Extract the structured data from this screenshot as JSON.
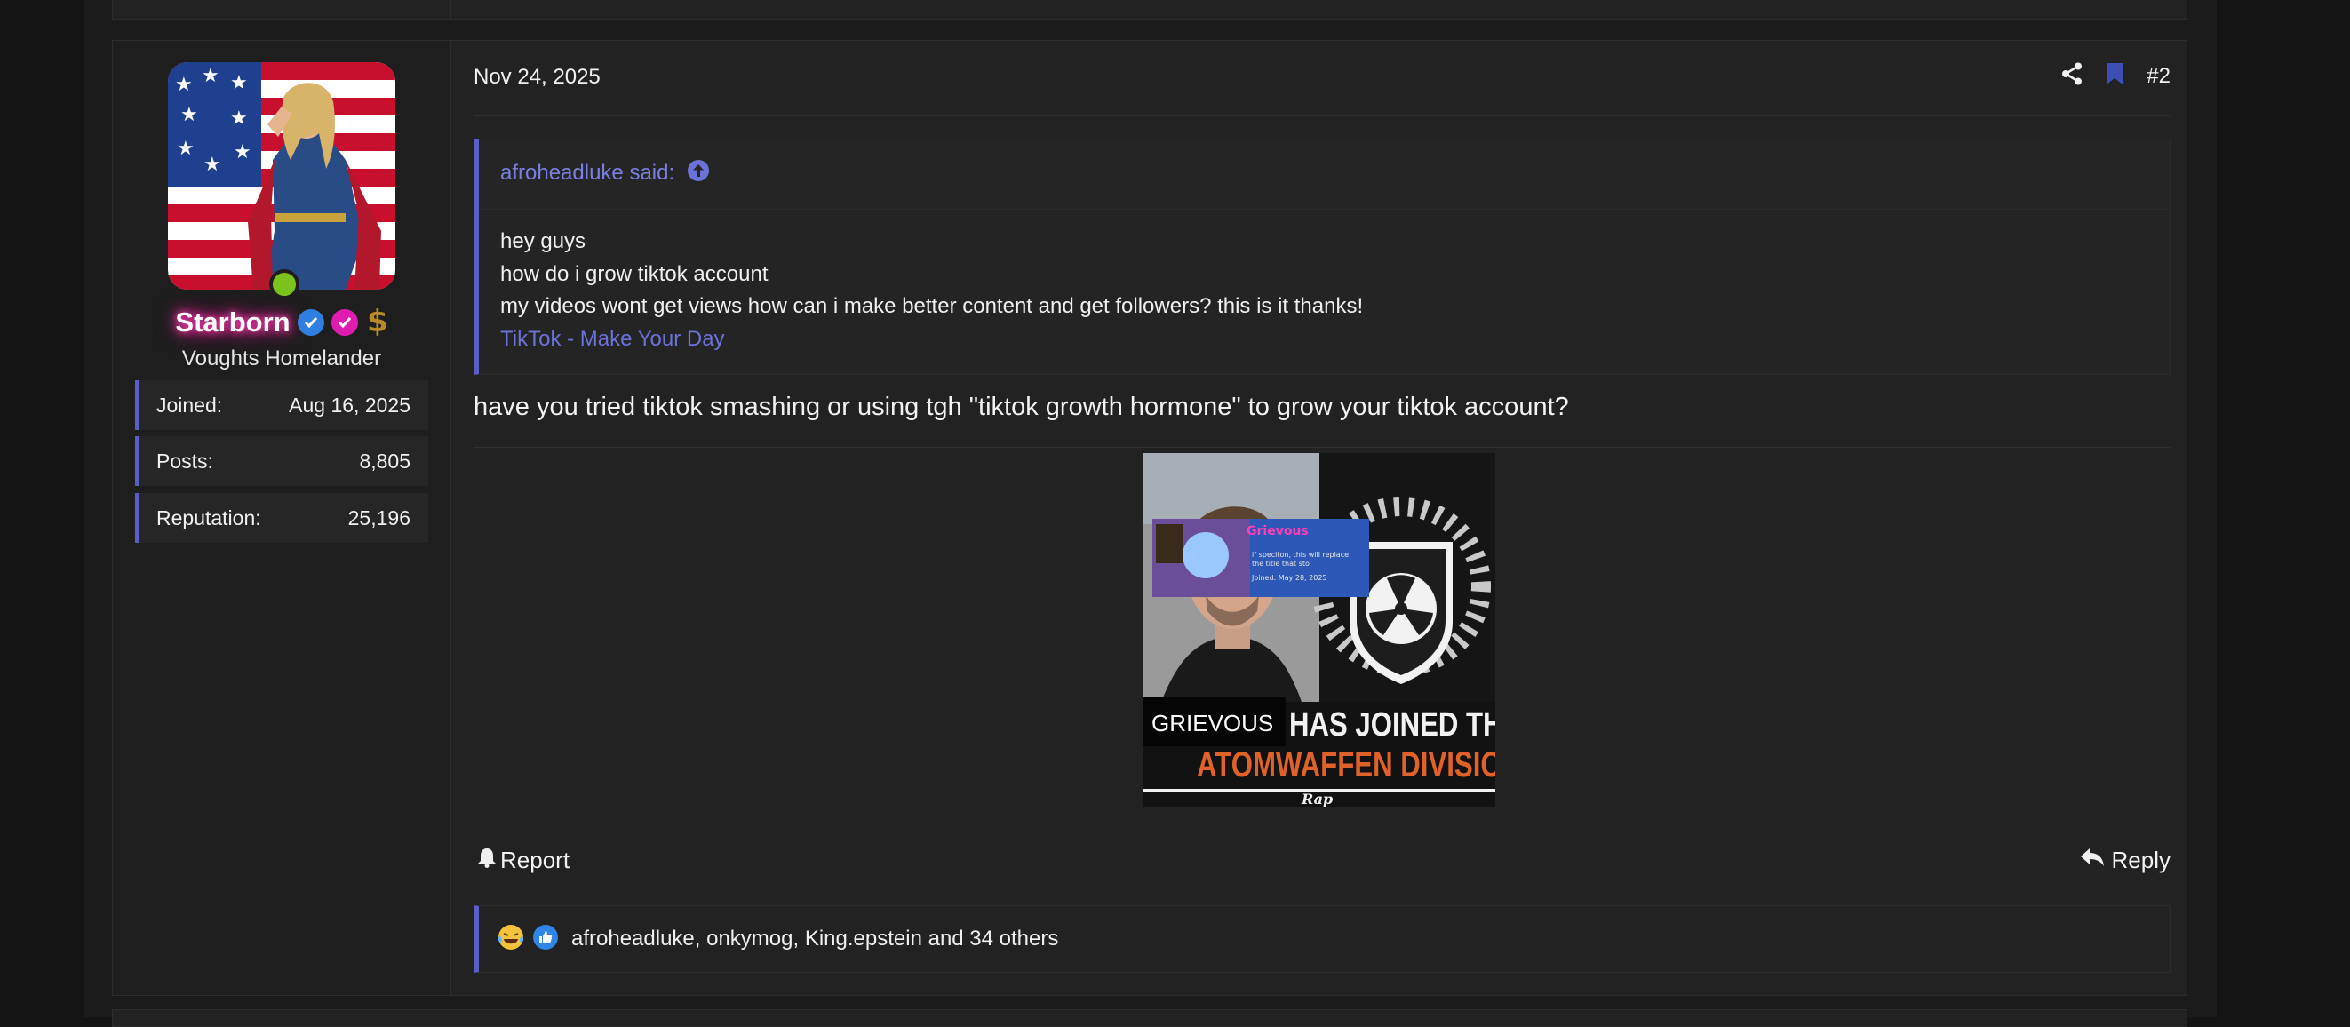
{
  "post": {
    "date": "Nov 24, 2025",
    "number": "#2",
    "icons": {
      "share": "share-icon",
      "bookmark": "bookmark-icon"
    },
    "author": {
      "username": "Starborn",
      "title": "Voughts Homelander",
      "online": true,
      "badges": [
        "verified-icon",
        "checkmark-badge-icon",
        "dollar-icon"
      ],
      "stats": [
        {
          "label": "Joined:",
          "value": "Aug 16, 2025"
        },
        {
          "label": "Posts:",
          "value": "8,805"
        },
        {
          "label": "Reputation:",
          "value": "25,196"
        }
      ]
    },
    "quote": {
      "author": "afroheadluke said:",
      "lines": [
        "hey guys",
        "how do i grow tiktok account",
        "my videos wont get views how can i make better content and get followers? this is it thanks!"
      ],
      "link": "TikTok - Make Your Day"
    },
    "body": "have you tried tiktok smashing or using tgh \"tiktok growth hormone\" to grow your tiktok account?",
    "image": {
      "inset_name": "Grievous",
      "inset_text_1": "if speciton, this will replace",
      "inset_text_2": "the title that sto",
      "inset_joined": "Joined: May 28, 2025",
      "name_label": "GRIEVOUS",
      "headline_1": "HAS JOINED THE",
      "headline_2": "ATOMWAFFEN DIVISION",
      "signature": "Rap"
    },
    "actions": {
      "report": "Report",
      "reply": "Reply"
    },
    "reactions": {
      "text": "afroheadluke, onkymog, King.epstein and 34 others"
    }
  },
  "colors": {
    "accent": "#5b5ec8",
    "link": "#6b72d8",
    "online": "#7cc21c",
    "username_glow": "#ff3fb5"
  }
}
